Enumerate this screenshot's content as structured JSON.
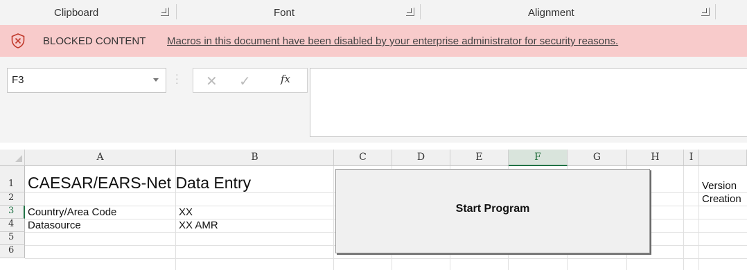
{
  "ribbon": {
    "groups": [
      "Clipboard",
      "Font",
      "Alignment"
    ]
  },
  "message_bar": {
    "title": "BLOCKED CONTENT",
    "text": "Macros in this document have been disabled by your enterprise administrator for security reasons.",
    "icon": "shield-x-icon",
    "color": "#f8cbcb"
  },
  "formula": {
    "name_box": "F3",
    "cancel_symbol": "✕",
    "enter_symbol": "✓",
    "fx_label": "fx",
    "value": ""
  },
  "grid": {
    "columns": [
      "A",
      "B",
      "C",
      "D",
      "E",
      "F",
      "G",
      "H",
      "I"
    ],
    "rows": [
      "1",
      "2",
      "3",
      "4",
      "5",
      "6"
    ],
    "selected_cell": "F3",
    "cells": {
      "A1": "CAESAR/EARS-Net Data Entry",
      "A3": "Country/Area Code",
      "B3": "XX",
      "A4": "Datasource",
      "B4": "XX AMR",
      "J1": "Version",
      "J2": "Creation"
    }
  },
  "start_button": {
    "label": "Start Program"
  },
  "accent": "#217346"
}
